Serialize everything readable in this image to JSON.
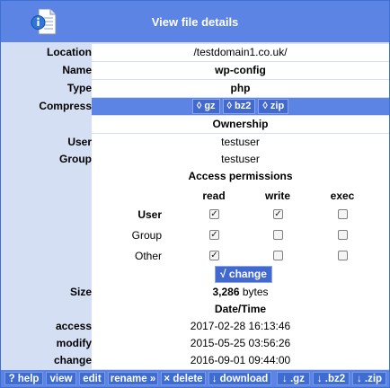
{
  "header": {
    "title": "View file details",
    "icon": "file-info-icon"
  },
  "fields": {
    "location": {
      "label": "Location",
      "value": "/testdomain1.co.uk/"
    },
    "name": {
      "label": "Name",
      "value": "wp-config"
    },
    "type": {
      "label": "Type",
      "value": "php"
    },
    "compress": {
      "label": "Compress",
      "options": [
        "◊ gz",
        "◊ bz2",
        "◊ zip"
      ]
    }
  },
  "ownership": {
    "title": "Ownership",
    "user": {
      "label": "User",
      "value": "testuser"
    },
    "group": {
      "label": "Group",
      "value": "testuser"
    }
  },
  "permissions": {
    "title": "Access permissions",
    "columns": [
      "read",
      "write",
      "exec"
    ],
    "rows": [
      {
        "label": "User",
        "read": true,
        "write": true,
        "exec": false
      },
      {
        "label": "Group",
        "read": true,
        "write": false,
        "exec": false
      },
      {
        "label": "Other",
        "read": true,
        "write": false,
        "exec": false
      }
    ],
    "change_label": "√ change"
  },
  "size": {
    "label": "Size",
    "value": "3,286",
    "unit": "bytes"
  },
  "datetime": {
    "title": "Date/Time",
    "access": {
      "label": "access",
      "value": "2017-02-28 16:13:46"
    },
    "modify": {
      "label": "modify",
      "value": "2015-05-25 03:56:26"
    },
    "change": {
      "label": "change",
      "value": "2016-09-01 09:44:00"
    }
  },
  "footer": {
    "buttons": [
      "? help",
      "view",
      "edit",
      "rename »",
      "× delete",
      "↓ download",
      "↓ .gz",
      "↓ .bz2",
      "↓ .zip"
    ]
  },
  "colors": {
    "accent": "#5b84e4",
    "button": "#3f6cd0",
    "panel": "#d4dff4"
  }
}
